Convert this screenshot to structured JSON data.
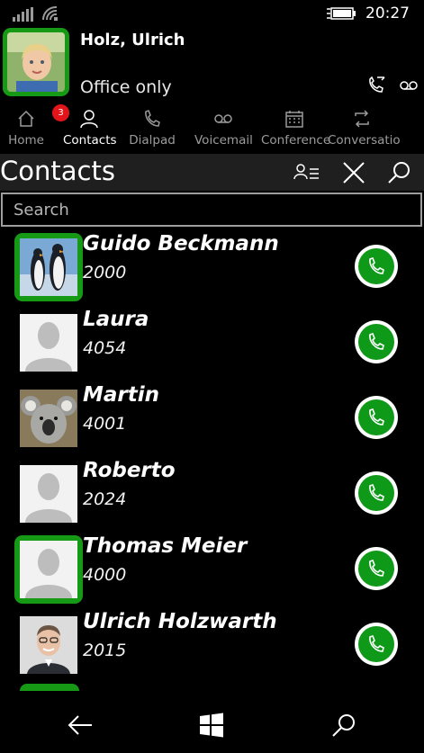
{
  "status_bar": {
    "time": "20:27"
  },
  "user": {
    "name": "Holz, Ulrich",
    "status": "Office only"
  },
  "tabs": [
    {
      "label": "Home",
      "badge": "3"
    },
    {
      "label": "Contacts"
    },
    {
      "label": "Dialpad"
    },
    {
      "label": "Voicemail"
    },
    {
      "label": "Conference"
    },
    {
      "label": "Conversatio"
    }
  ],
  "page": {
    "title": "Contacts",
    "search_placeholder": "Search"
  },
  "contacts": [
    {
      "name": "Guido Beckmann",
      "number": "2000",
      "favorite": true,
      "avatar": "penguins-photo"
    },
    {
      "name": "Laura",
      "number": "4054",
      "favorite": false,
      "avatar": "default-person"
    },
    {
      "name": "Martin",
      "number": "4001",
      "favorite": false,
      "avatar": "koala-photo"
    },
    {
      "name": "Roberto",
      "number": "2024",
      "favorite": false,
      "avatar": "default-person"
    },
    {
      "name": "Thomas Meier",
      "number": "4000",
      "favorite": true,
      "avatar": "default-person"
    },
    {
      "name": "Ulrich Holzwarth",
      "number": "2015",
      "favorite": false,
      "avatar": "man-portrait-photo"
    }
  ],
  "colors": {
    "favorite_ring": "#169a16",
    "call_button": "#0e9a18",
    "badge": "#e3151a",
    "titlebar": "#1f1f1f"
  }
}
